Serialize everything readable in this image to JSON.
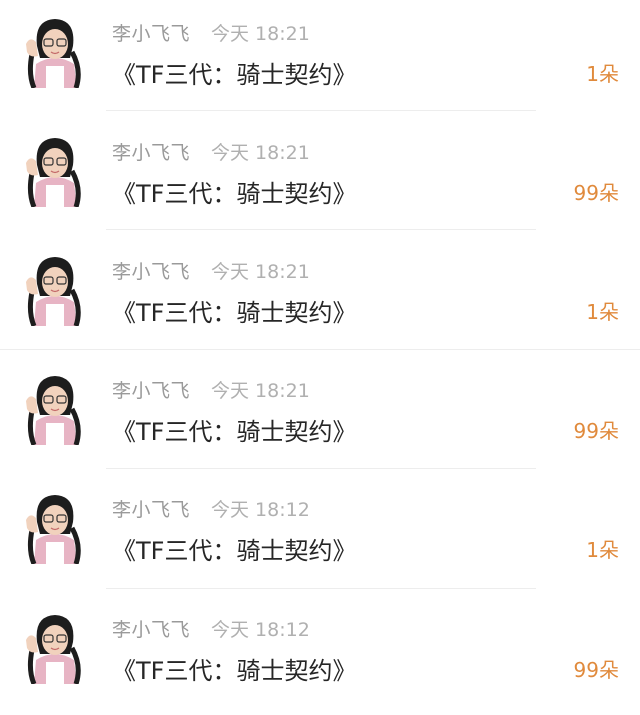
{
  "gift_records": [
    {
      "sender": "李小飞飞",
      "time": "今天 18:21",
      "gift": "《TF三代：骑士契约》",
      "count": "1朵"
    },
    {
      "sender": "李小飞飞",
      "time": "今天 18:21",
      "gift": "《TF三代：骑士契约》",
      "count": "99朵"
    },
    {
      "sender": "李小飞飞",
      "time": "今天 18:21",
      "gift": "《TF三代：骑士契约》",
      "count": "1朵"
    },
    {
      "sender": "李小飞飞",
      "time": "今天 18:21",
      "gift": "《TF三代：骑士契约》",
      "count": "99朵"
    },
    {
      "sender": "李小飞飞",
      "time": "今天 18:12",
      "gift": "《TF三代：骑士契约》",
      "count": "1朵"
    },
    {
      "sender": "李小飞飞",
      "time": "今天 18:12",
      "gift": "《TF三代：骑士契约》",
      "count": "99朵"
    }
  ],
  "colors": {
    "count_accent": "#e08a3c",
    "sender_text": "#9a9a9a",
    "body_text": "#262626"
  }
}
